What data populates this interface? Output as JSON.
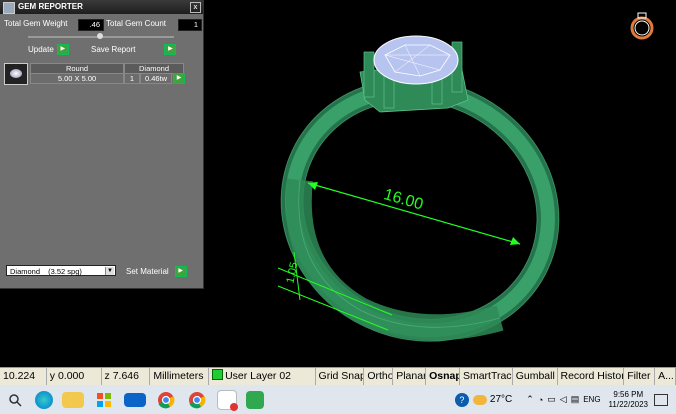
{
  "panel": {
    "title": "GEM REPORTER",
    "close_glyph": "x",
    "total_weight_label": "Total Gem Weight",
    "total_weight_value": ".46",
    "total_count_label": "Total Gem Count",
    "total_count_value": "1",
    "update_label": "Update",
    "save_report_label": "Save Report",
    "table": {
      "headers": [
        "Round",
        "Diamond"
      ],
      "row": {
        "size": "5.00 X 5.00",
        "count": "1",
        "weight": "0.46tw"
      }
    },
    "material_select": {
      "value": "Diamond",
      "spg": "(3.52 spg)"
    },
    "set_material_label": "Set Material"
  },
  "viewport": {
    "dimension_main": "16.00",
    "dimension_side": "1.05",
    "ring_color": "#2e8b57",
    "annotation_color": "#22ff22"
  },
  "statusbar": {
    "x": "10.224",
    "y": "y 0.000",
    "z": "z 7.646",
    "units": "Millimeters",
    "layer": "User Layer 02",
    "toggles": [
      "Grid Snap",
      "Ortho",
      "Planar",
      "Osnap",
      "SmartTrack",
      "Gumball",
      "Record History",
      "Filter",
      "A..."
    ],
    "bold_toggle": "Osnap"
  },
  "taskbar": {
    "icons": [
      "search-icon",
      "edge-icon",
      "file-explorer-icon",
      "store-icon",
      "mail-icon",
      "chrome-icon",
      "chrome-icon-2",
      "notification-app-icon",
      "green-app-icon"
    ],
    "weather": "27°C",
    "lang": "ENG",
    "time": "9:56 PM",
    "date": "11/22/2023"
  }
}
